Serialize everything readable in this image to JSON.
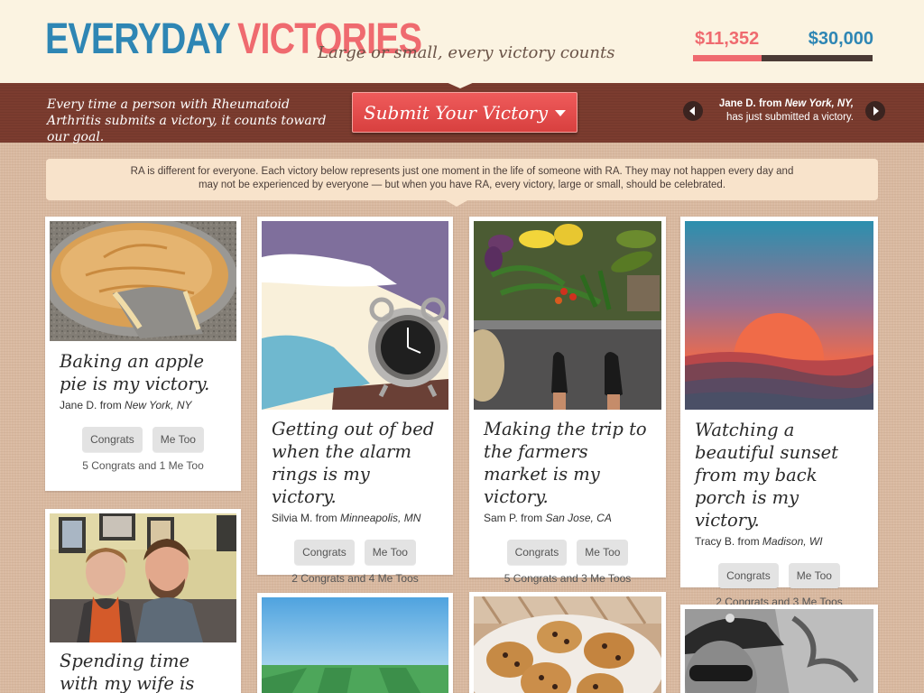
{
  "header": {
    "logo_part1": "EVERYDAY",
    "logo_part2": "VICTORIES",
    "tagline": "Large or small, every victory counts",
    "raised": "$11,352",
    "goal": "$30,000",
    "progress_fraction": 0.38,
    "colors": {
      "blue": "#2e86b4",
      "coral": "#ef6a6f"
    }
  },
  "banner": {
    "text": "Every time a person with Rheumatoid Arthritis submits a victory, it counts toward our goal.",
    "submit_label": "Submit Your Victory",
    "ticker_name": "Jane D. from",
    "ticker_place": "New York, NY,",
    "ticker_action": "has just submitted a victory."
  },
  "note": {
    "text": "RA is different for everyone. Each victory below represents just one moment in the life of someone with RA. They may not happen every day and may not be experienced by everyone — but when you have RA, every victory, large or small, should be celebrated."
  },
  "buttons": {
    "congrats": "Congrats",
    "metoo": "Me Too"
  },
  "cards": [
    {
      "title": "Baking an apple pie is my victory.",
      "author": "Jane D. from ",
      "place": "New York, NY",
      "counts": "5 Congrats and 1 Me Too",
      "image": "apple-pie-photo"
    },
    {
      "title": "Getting out of bed when the alarm rings is my victory.",
      "author": "Silvia M. from ",
      "place": "Minneapolis, MN",
      "counts": "2 Congrats and 4 Me Toos",
      "image": "alarm-clock-illustration"
    },
    {
      "title": "Making the trip to the farmers market is my victory.",
      "author": "Sam P. from ",
      "place": "San Jose, CA",
      "counts": "5 Congrats and 3 Me Toos",
      "image": "farmers-market-photo"
    },
    {
      "title": "Watching a beautiful sunset from my back porch is my victory.",
      "author": "Tracy B. from ",
      "place": "Madison, WI",
      "counts": "2 Congrats and 3 Me Toos",
      "image": "sunset-illustration"
    },
    {
      "title": "Spending time with my wife is my",
      "image": "couple-photo"
    }
  ]
}
